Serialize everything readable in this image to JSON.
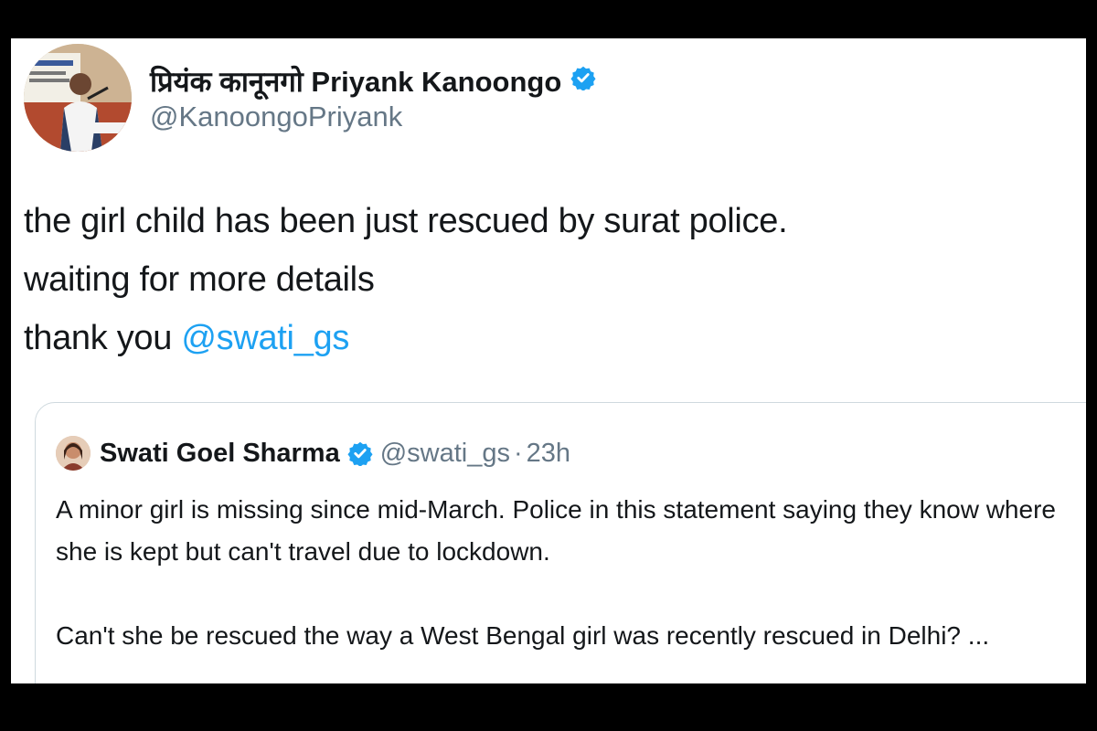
{
  "tweet": {
    "author_name": "प्रियंक कानूनगो Priyank Kanoongo",
    "author_handle": "@KanoongoPriyank",
    "lines": [
      "the girl child has been just rescued by surat police.",
      "waiting for more details",
      "thank you "
    ],
    "mention": "@swati_gs"
  },
  "quoted": {
    "author_name": "Swati Goel Sharma",
    "author_handle": "@swati_gs",
    "separator": "·",
    "time": "23h",
    "paragraph1": "A minor girl is missing since mid-March. Police in this statement saying they know where she is kept but can't travel due to lockdown.",
    "paragraph2": "Can't she be rescued the way a West Bengal girl was recently rescued in Delhi? ..."
  },
  "colors": {
    "verified": "#1da1f2",
    "mention": "#1da1f2",
    "secondary_text": "#657786",
    "border": "#cfd9de"
  },
  "icons": {
    "verified": "verified-badge-icon"
  }
}
